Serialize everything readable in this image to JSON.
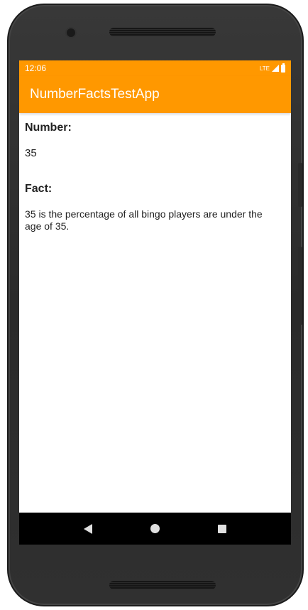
{
  "status_bar": {
    "time": "12:06",
    "network": "LTE",
    "icons": [
      "signal-icon",
      "battery-icon"
    ]
  },
  "app_bar": {
    "title": "NumberFactsTestApp"
  },
  "content": {
    "number_label": "Number:",
    "number_value": "35",
    "fact_label": "Fact:",
    "fact_value": "35 is the percentage of all bingo players are under the age of 35."
  },
  "nav_bar": {
    "icons": [
      "back-icon",
      "home-icon",
      "recents-icon"
    ]
  },
  "colors": {
    "primary": "#ff9800",
    "text": "#222222",
    "nav_background": "#000000"
  }
}
